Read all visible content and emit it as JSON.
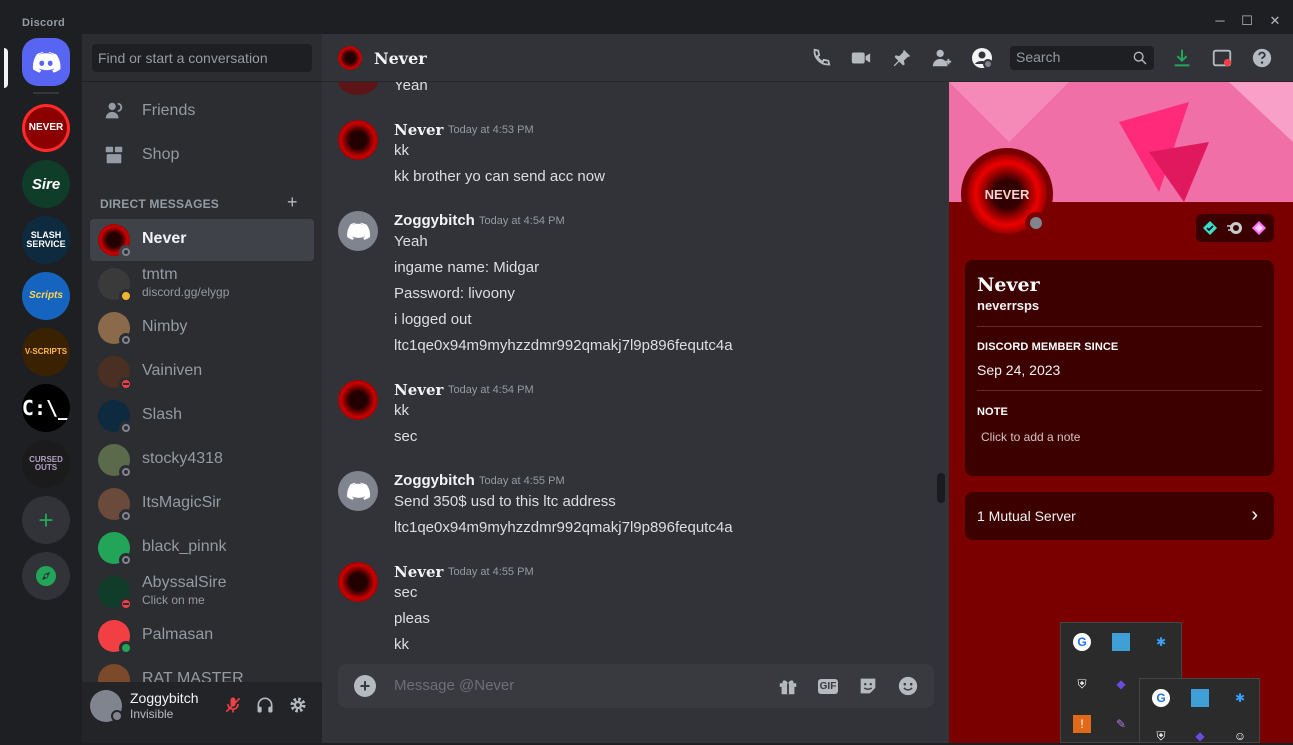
{
  "app": {
    "title": "Discord"
  },
  "window_controls": {
    "minimize": "─",
    "maximize": "☐",
    "close": "✕"
  },
  "guilds": [
    {
      "label": "NEVER",
      "color": "#8b0000"
    },
    {
      "label": "Sire",
      "color": "#0f3d2a"
    },
    {
      "label": "SLASH SERVICE",
      "color": "#0d2a3f"
    },
    {
      "label": "Scripts",
      "color": "#1565c0"
    },
    {
      "label": "V-SCRIPTS",
      "color": "#3a2200"
    },
    {
      "label": "C:\\_",
      "color": "#000000"
    },
    {
      "label": "CURSED OUTS",
      "color": "#1b1b1b"
    }
  ],
  "sidebar": {
    "search_placeholder": "Find or start a conversation",
    "friends": "Friends",
    "shop": "Shop",
    "dm_header": "DIRECT MESSAGES",
    "dm_add": "+",
    "dms": [
      {
        "name": "Never",
        "sub": "",
        "status": "off",
        "color": "#8b0000"
      },
      {
        "name": "tmtm",
        "sub": "discord.gg/elygp",
        "status": "idle",
        "color": "#3a3a3a"
      },
      {
        "name": "Nimby",
        "sub": "",
        "status": "off",
        "color": "#8a6a4a"
      },
      {
        "name": "Vainiven",
        "sub": "",
        "status": "dnd",
        "color": "#4a3022"
      },
      {
        "name": "Slash",
        "sub": "",
        "status": "off",
        "color": "#0d2a3f"
      },
      {
        "name": "stocky4318",
        "sub": "",
        "status": "off",
        "color": "#5a6a4a"
      },
      {
        "name": "ItsMagicSir",
        "sub": "",
        "status": "off",
        "color": "#6a4a3a"
      },
      {
        "name": "black_pinnk",
        "sub": "",
        "status": "off",
        "color": "#23a559"
      },
      {
        "name": "AbyssalSire",
        "sub": "Click on me",
        "status": "dnd",
        "color": "#0f3d2a"
      },
      {
        "name": "Palmasan",
        "sub": "",
        "status": "on",
        "color": "#f23f43"
      },
      {
        "name": "RAT MASTER",
        "sub": "",
        "status": "off",
        "color": "#7a4a2a"
      }
    ]
  },
  "user": {
    "name": "Zoggybitch",
    "status": "Invisible"
  },
  "header": {
    "name": "Never",
    "search_placeholder": "Search"
  },
  "messages": [
    {
      "author": "",
      "time": "",
      "lines": [
        "Yeah"
      ],
      "kind": "never",
      "continued": true
    },
    {
      "author": "Never",
      "time": "Today at 4:53 PM",
      "lines": [
        "kk",
        "kk brother yo can send acc now"
      ],
      "kind": "never"
    },
    {
      "author": "Zoggybitch",
      "time": "Today at 4:54 PM",
      "lines": [
        "Yeah",
        "ingame name: Midgar",
        "Password: livoony",
        "i logged out",
        "ltc1qe0x94m9myhzzdmr992qmakj7l9p896fequtc4a"
      ],
      "kind": "zoggy"
    },
    {
      "author": "Never",
      "time": "Today at 4:54 PM",
      "lines": [
        "kk",
        "sec"
      ],
      "kind": "never"
    },
    {
      "author": "Zoggybitch",
      "time": "Today at 4:55 PM",
      "lines": [
        "Send 350$ usd to this ltc address",
        "ltc1qe0x94m9myhzzdmr992qmakj7l9p896fequtc4a"
      ],
      "kind": "zoggy"
    },
    {
      "author": "Never",
      "time": "Today at 4:55 PM",
      "lines": [
        "sec",
        "pleas",
        "kk"
      ],
      "kind": "never"
    }
  ],
  "composer": {
    "placeholder": "Message @Never",
    "gif": "GIF"
  },
  "profile": {
    "avatar_text": "NEVER",
    "display_name": "Never",
    "username": "neverrsps",
    "member_since_label": "DISCORD MEMBER SINCE",
    "member_since": "Sep 24, 2023",
    "note_label": "NOTE",
    "note_placeholder": "Click to add a note",
    "mutual_servers": "1 Mutual Server"
  },
  "colors": {
    "accent": "#5865f2",
    "profile_bg": "#7a0000",
    "banner": "#f06fa6",
    "green": "#23a559"
  }
}
